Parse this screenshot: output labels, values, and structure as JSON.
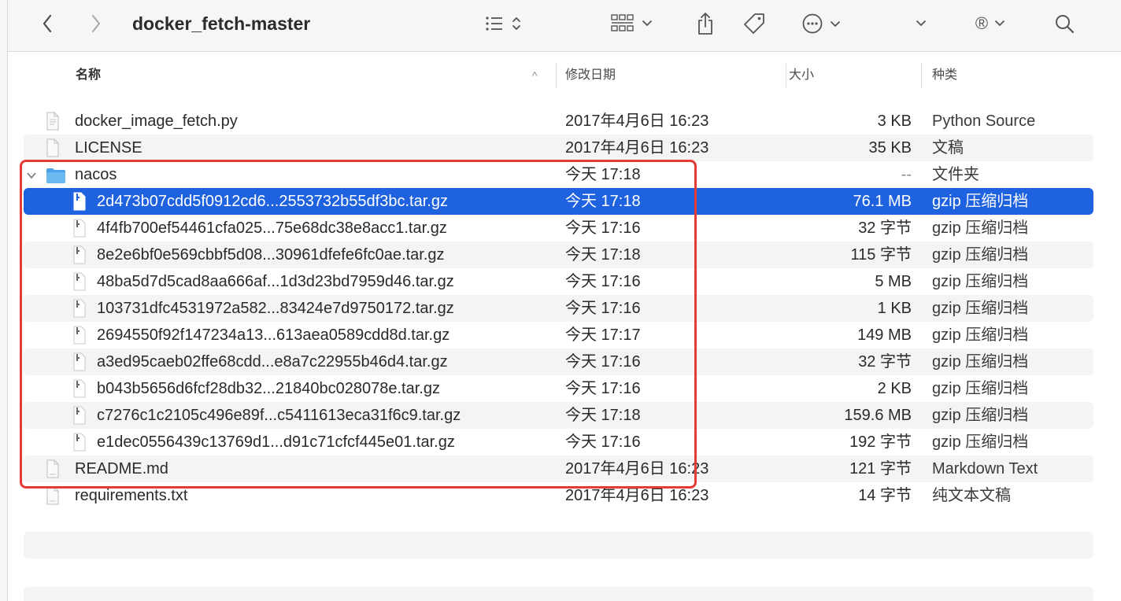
{
  "window": {
    "title": "docker_fetch-master"
  },
  "toolbar": {
    "back_icon": "chevron-left-icon",
    "forward_icon": "chevron-right-icon",
    "view_icon": "list-view-icon",
    "group_icon": "grid-group-icon",
    "share_icon": "share-icon",
    "tag_icon": "tag-icon",
    "more_icon": "ellipsis-circle-icon",
    "dropdown_icon": "chevron-down-icon",
    "registered_symbol": "®",
    "search_icon": "search-icon"
  },
  "columns": {
    "name": "名称",
    "date": "修改日期",
    "size": "大小",
    "kind": "种类",
    "sort_indicator": "^"
  },
  "files": [
    {
      "name": "docker_image_fetch.py",
      "date": "2017年4月6日 16:23",
      "size": "3 KB",
      "kind": "Python Source",
      "icon": "python-file-icon"
    },
    {
      "name": "LICENSE",
      "date": "2017年4月6日 16:23",
      "size": "35 KB",
      "kind": "文稿",
      "icon": "document-icon"
    },
    {
      "name": "nacos",
      "date": "今天 17:18",
      "size": "--",
      "kind": "文件夹",
      "icon": "folder-icon",
      "expanded": true
    },
    {
      "name": "2d473b07cdd5f0912cd6...2553732b55df3bc.tar.gz",
      "date": "今天 17:18",
      "size": "76.1 MB",
      "kind": "gzip 压缩归档",
      "icon": "archive-file-icon",
      "selected": true
    },
    {
      "name": "4f4fb700ef54461cfa025...75e68dc38e8acc1.tar.gz",
      "date": "今天 17:16",
      "size": "32 字节",
      "kind": "gzip 压缩归档",
      "icon": "archive-file-icon"
    },
    {
      "name": "8e2e6bf0e569cbbf5d08...30961dfefe6fc0ae.tar.gz",
      "date": "今天 17:18",
      "size": "115 字节",
      "kind": "gzip 压缩归档",
      "icon": "archive-file-icon"
    },
    {
      "name": "48ba5d7d5cad8aa666af...1d3d23bd7959d46.tar.gz",
      "date": "今天 17:16",
      "size": "5 MB",
      "kind": "gzip 压缩归档",
      "icon": "archive-file-icon"
    },
    {
      "name": "103731dfc4531972a582...83424e7d9750172.tar.gz",
      "date": "今天 17:16",
      "size": "1 KB",
      "kind": "gzip 压缩归档",
      "icon": "archive-file-icon"
    },
    {
      "name": "2694550f92f147234a13...613aea0589cdd8d.tar.gz",
      "date": "今天 17:17",
      "size": "149 MB",
      "kind": "gzip 压缩归档",
      "icon": "archive-file-icon"
    },
    {
      "name": "a3ed95caeb02ffe68cdd...e8a7c22955b46d4.tar.gz",
      "date": "今天 17:16",
      "size": "32 字节",
      "kind": "gzip 压缩归档",
      "icon": "archive-file-icon"
    },
    {
      "name": "b043b5656d6fcf28db32...21840bc028078e.tar.gz",
      "date": "今天 17:16",
      "size": "2 KB",
      "kind": "gzip 压缩归档",
      "icon": "archive-file-icon"
    },
    {
      "name": "c7276c1c2105c496e89f...c5411613eca31f6c9.tar.gz",
      "date": "今天 17:18",
      "size": "159.6 MB",
      "kind": "gzip 压缩归档",
      "icon": "archive-file-icon"
    },
    {
      "name": "e1dec0556439c13769d1...d91c71cfcf445e01.tar.gz",
      "date": "今天 17:16",
      "size": "192 字节",
      "kind": "gzip 压缩归档",
      "icon": "archive-file-icon"
    },
    {
      "name": "README.md",
      "date": "2017年4月6日 16:23",
      "size": "121 字节",
      "kind": "Markdown Text",
      "icon": "markdown-file-icon"
    },
    {
      "name": "requirements.txt",
      "date": "2017年4月6日 16:23",
      "size": "14 字节",
      "kind": "纯文本文稿",
      "icon": "text-file-icon"
    }
  ],
  "colors": {
    "selection": "#1f62e0",
    "highlight_box": "#e63a35",
    "folder": "#4aa3e8"
  }
}
